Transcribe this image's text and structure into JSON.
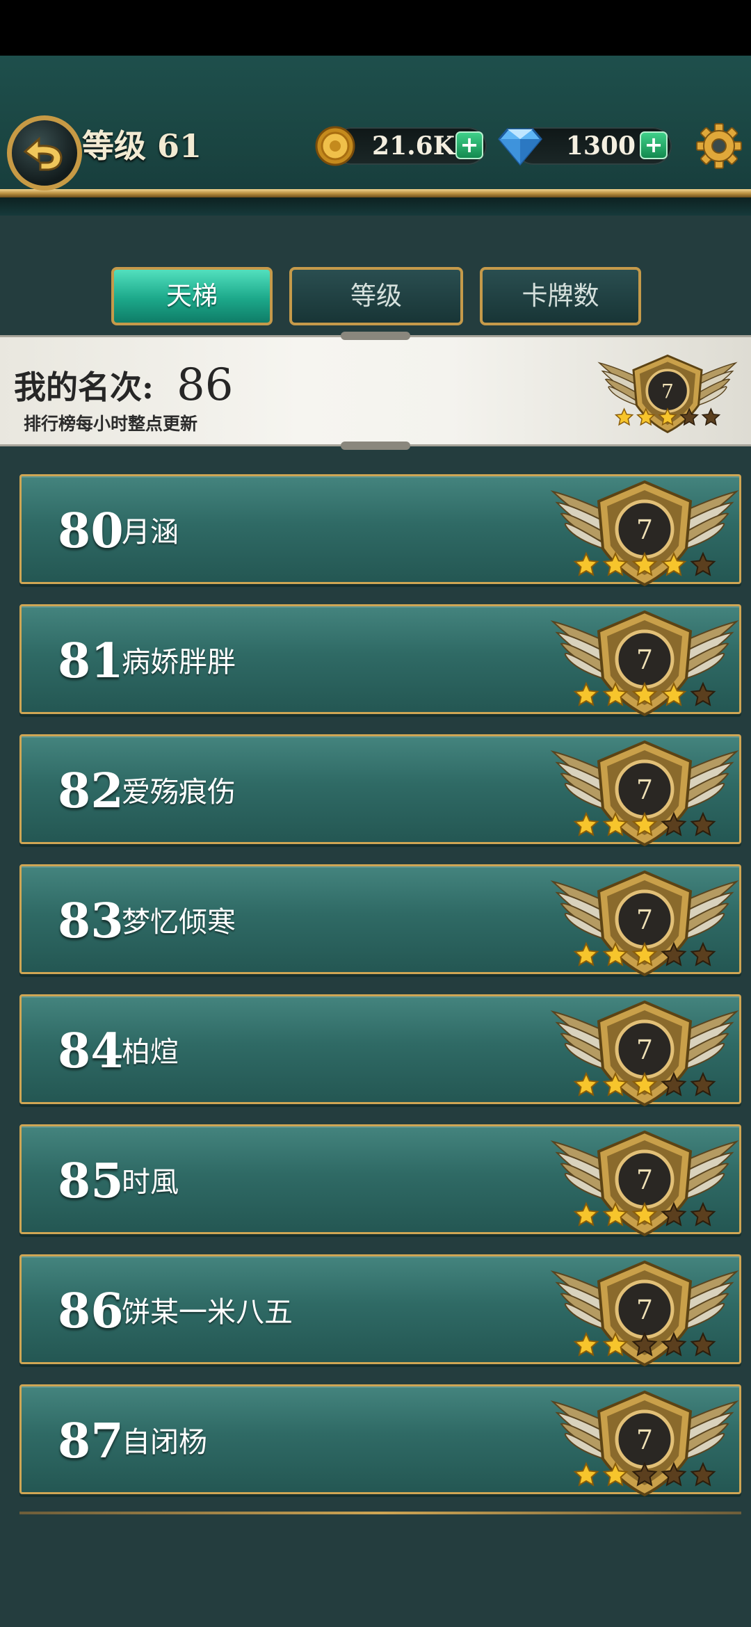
{
  "header": {
    "level_text": "等级 61",
    "coins": "21.6K",
    "gems": "1300",
    "plus_symbol": "+",
    "icons": [
      "back-arrow-icon",
      "coin-icon",
      "gem-icon",
      "gear-icon"
    ]
  },
  "tabs": [
    {
      "label": "天梯",
      "active": true
    },
    {
      "label": "等级",
      "active": false
    },
    {
      "label": "卡牌数",
      "active": false
    }
  ],
  "my_rank": {
    "label": "我的名次:",
    "value": "86",
    "note": "排行榜每小时整点更新",
    "badge_number": "7",
    "stars": 3,
    "stars_total": 5
  },
  "rows": [
    {
      "rank": "80",
      "name": "月涵",
      "badge_number": "7",
      "stars": 4
    },
    {
      "rank": "81",
      "name": "病娇胖胖",
      "badge_number": "7",
      "stars": 4
    },
    {
      "rank": "82",
      "name": "爱殇痕伤",
      "badge_number": "7",
      "stars": 3
    },
    {
      "rank": "83",
      "name": "梦忆倾寒",
      "badge_number": "7",
      "stars": 3
    },
    {
      "rank": "84",
      "name": "柏煊",
      "badge_number": "7",
      "stars": 3
    },
    {
      "rank": "85",
      "name": "时風",
      "badge_number": "7",
      "stars": 3
    },
    {
      "rank": "86",
      "name": "饼某一米八五",
      "badge_number": "7",
      "stars": 2
    },
    {
      "rank": "87",
      "name": "自闭杨",
      "badge_number": "7",
      "stars": 2
    }
  ],
  "colors": {
    "accent_teal": "#1ca88a",
    "gold": "#cfa654",
    "star_on": "#f7c52c",
    "star_off": "#5b3f1e"
  }
}
